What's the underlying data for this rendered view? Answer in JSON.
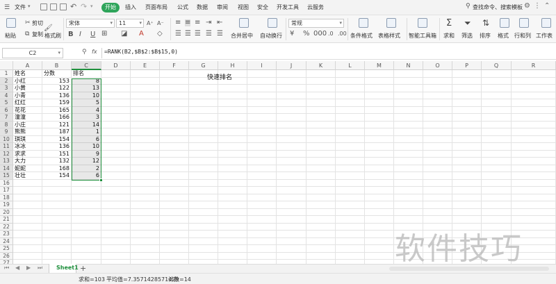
{
  "menu": {
    "file": "文件",
    "items": [
      "开始",
      "插入",
      "页面布局",
      "公式",
      "数据",
      "审阅",
      "视图",
      "安全",
      "开发工具",
      "云服务"
    ],
    "active": "开始",
    "search": "查找命令、搜索模板"
  },
  "ribbon": {
    "cut": "剪切",
    "copy": "复制",
    "format_painter": "格式刷",
    "paste": "粘贴",
    "font_name": "宋体",
    "font_size": "11",
    "merge": "合并居中",
    "wrap": "自动换行",
    "number_format": "常规",
    "cond_format": "条件格式",
    "table_style": "表格样式",
    "smart_tools": "智能工具箱",
    "sum": "求和",
    "filter": "筛选",
    "sort": "排序",
    "format": "格式",
    "rows_cols": "行和列",
    "worksheet": "工作表",
    "bold": "B",
    "italic": "I",
    "underline": "U"
  },
  "formula_bar": {
    "name_box": "C2",
    "fx": "fx",
    "formula": "=RANK(B2,$B$2:$B$15,0)"
  },
  "columns": [
    "A",
    "B",
    "C",
    "D",
    "E",
    "F",
    "G",
    "H",
    "I",
    "J",
    "K",
    "L",
    "M",
    "N",
    "O",
    "P",
    "Q",
    "R"
  ],
  "rows": [
    "1",
    "2",
    "3",
    "4",
    "5",
    "6",
    "7",
    "8",
    "9",
    "10",
    "11",
    "12",
    "13",
    "14",
    "15",
    "16",
    "17",
    "18",
    "19",
    "20",
    "21",
    "22",
    "23",
    "24",
    "25",
    "26",
    "27"
  ],
  "headers": {
    "name": "姓名",
    "score": "分数",
    "rank": "排名"
  },
  "data": [
    {
      "name": "小红",
      "score": "153",
      "rank": "8"
    },
    {
      "name": "小黄",
      "score": "122",
      "rank": "13"
    },
    {
      "name": "小青",
      "score": "136",
      "rank": "10"
    },
    {
      "name": "红红",
      "score": "159",
      "rank": "5"
    },
    {
      "name": "花花",
      "score": "165",
      "rank": "4"
    },
    {
      "name": "潼潼",
      "score": "166",
      "rank": "3"
    },
    {
      "name": "小庄",
      "score": "121",
      "rank": "14"
    },
    {
      "name": "熊熊",
      "score": "187",
      "rank": "1"
    },
    {
      "name": "琪琪",
      "score": "154",
      "rank": "6"
    },
    {
      "name": "冰冰",
      "score": "136",
      "rank": "10"
    },
    {
      "name": "求求",
      "score": "151",
      "rank": "9"
    },
    {
      "name": "大力",
      "score": "132",
      "rank": "12"
    },
    {
      "name": "妮妮",
      "score": "168",
      "rank": "2"
    },
    {
      "name": "壮壮",
      "score": "154",
      "rank": "6"
    }
  ],
  "sheet_title": "快速排名",
  "sheet_tab": "Sheet1",
  "status": {
    "sum": "求和=103",
    "avg": "平均值=7.3571428571429",
    "count": "计数=14"
  },
  "watermark": "软件技巧",
  "colors": {
    "accent": "#2ea45a",
    "selection": "#1e8f3c"
  }
}
